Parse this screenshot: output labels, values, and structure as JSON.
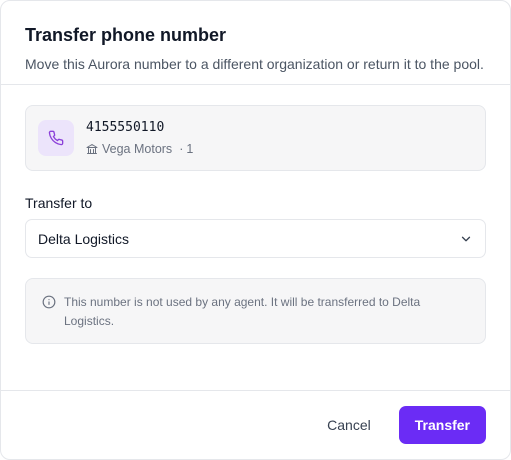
{
  "dialog": {
    "title": "Transfer phone number",
    "subtitle": "Move this Aurora number to a different organization or return it to the pool."
  },
  "number_card": {
    "phone_number": "4155550110",
    "organization": "Vega Motors",
    "separator": "·",
    "count": "1",
    "icon": "phone-icon",
    "org_icon": "building-icon"
  },
  "transfer_field": {
    "label": "Transfer to",
    "selected": "Delta Logistics",
    "icon": "chevron-down-icon"
  },
  "notice": {
    "icon": "info-icon",
    "text": "This number is not used by any agent. It will be transferred to Delta Logistics."
  },
  "footer": {
    "cancel_label": "Cancel",
    "transfer_label": "Transfer"
  },
  "colors": {
    "accent": "#6b2cf5",
    "phone_badge_bg": "#ece4fb",
    "card_bg": "#f6f6f7",
    "border": "#e5e7eb"
  }
}
